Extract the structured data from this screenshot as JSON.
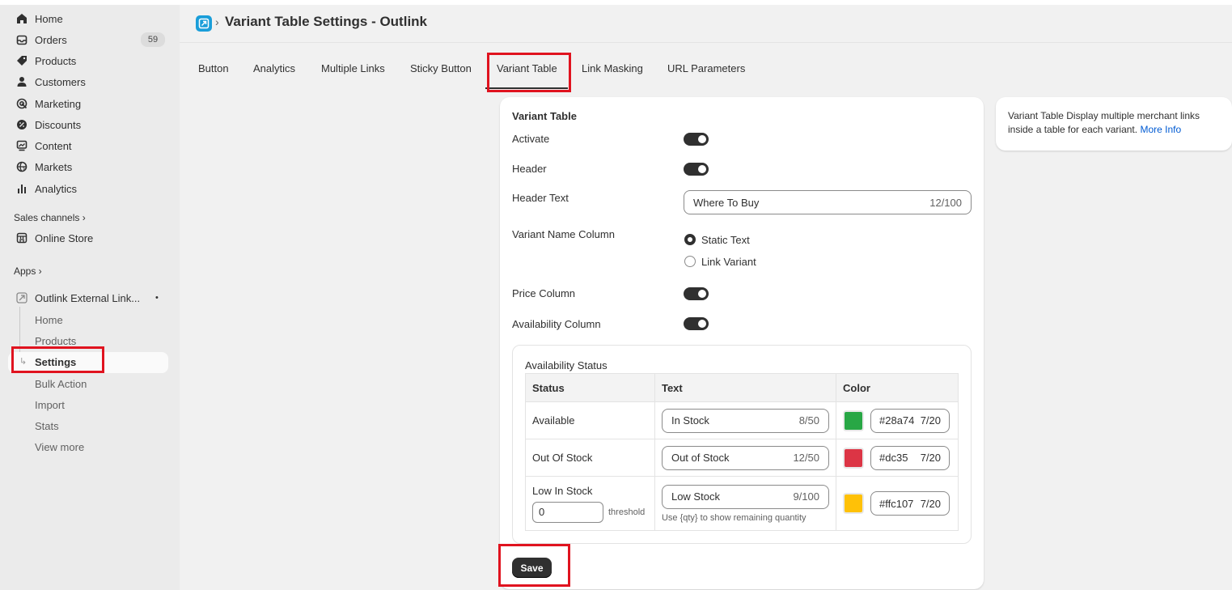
{
  "sidebar": {
    "nav": [
      {
        "label": "Home",
        "icon": "home-icon"
      },
      {
        "label": "Orders",
        "icon": "orders-icon",
        "badge": "59"
      },
      {
        "label": "Products",
        "icon": "tag-icon"
      },
      {
        "label": "Customers",
        "icon": "person-icon"
      },
      {
        "label": "Marketing",
        "icon": "target-icon"
      },
      {
        "label": "Discounts",
        "icon": "discount-icon"
      },
      {
        "label": "Content",
        "icon": "content-icon"
      },
      {
        "label": "Markets",
        "icon": "globe-icon"
      },
      {
        "label": "Analytics",
        "icon": "bar-chart-icon"
      }
    ],
    "sales_channels_label": "Sales channels ›",
    "online_store_label": "Online Store",
    "apps_label": "Apps ›",
    "app_name": "Outlink External Link...",
    "app_dot": "•",
    "app_sub": [
      "Home",
      "Products",
      "Settings",
      "Bulk Action",
      "Import",
      "Stats",
      "View more"
    ]
  },
  "header": {
    "separator": "›",
    "title": "Variant Table Settings - Outlink"
  },
  "tabs": [
    "Button",
    "Analytics",
    "Multiple Links",
    "Sticky Button",
    "Variant Table",
    "Link Masking",
    "URL Parameters"
  ],
  "active_tab": "Variant Table",
  "form": {
    "section_title": "Variant Table",
    "activate_label": "Activate",
    "activate_on": true,
    "header_label": "Header",
    "header_on": true,
    "header_text_label": "Header Text",
    "header_text_value": "Where To Buy",
    "header_text_count": "12/100",
    "variant_name_label": "Variant Name Column",
    "variant_options": [
      "Static Text",
      "Link Variant"
    ],
    "variant_selected": "Static Text",
    "price_label": "Price Column",
    "price_on": true,
    "availability_label": "Availability Column",
    "availability_on": true
  },
  "availability": {
    "title": "Availability Status",
    "columns": [
      "Status",
      "Text",
      "Color"
    ],
    "rows": [
      {
        "status": "Available",
        "text": "In Stock",
        "count": "8/50",
        "color": "#28a745",
        "hex": "#28a74",
        "hex_count": "7/20"
      },
      {
        "status": "Out Of Stock",
        "text": "Out of Stock",
        "count": "12/50",
        "color": "#dc3545",
        "hex": "#dc35",
        "hex_count": "7/20"
      },
      {
        "status": "Low In Stock",
        "text": "Low Stock",
        "count": "9/100",
        "color": "#ffc107",
        "hex": "#ffc107",
        "hex_count": "7/20",
        "threshold_value": "0",
        "threshold_label": "threshold",
        "help": "Use {qty} to show remaining quantity"
      }
    ]
  },
  "save_label": "Save",
  "info": {
    "text": "Variant Table Display multiple merchant links inside a table for each variant.",
    "link": "More Info"
  }
}
